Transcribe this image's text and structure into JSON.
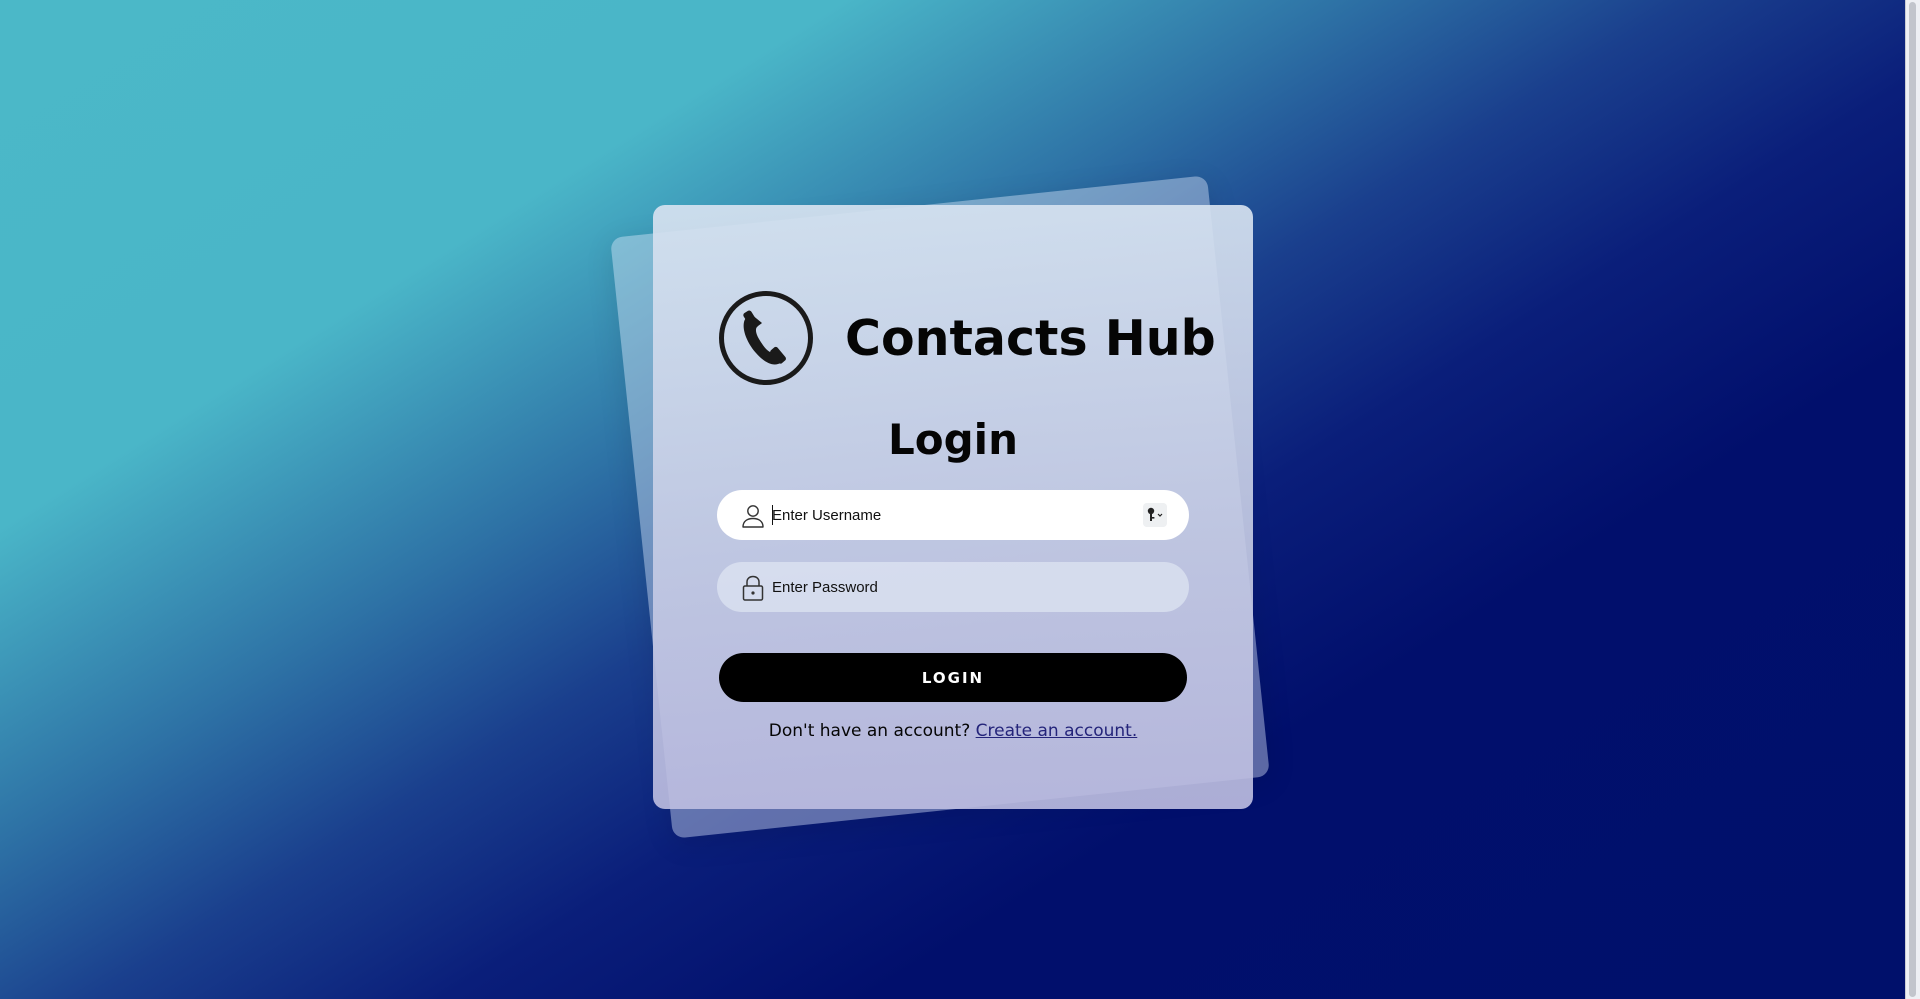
{
  "app": {
    "title": "Contacts Hub",
    "logo_icon": "phone-circle-icon"
  },
  "form": {
    "heading": "Login",
    "username": {
      "placeholder": "Enter Username",
      "value": "",
      "icon": "user-icon",
      "autofill_icon": "key-icon"
    },
    "password": {
      "placeholder": "Enter Password",
      "value": "",
      "icon": "lock-icon"
    },
    "submit_label": "LOGIN",
    "signup_prompt": "Don't have an account?",
    "signup_link": "Create an account."
  },
  "colors": {
    "gradient_start": "#4bb8c8",
    "gradient_end": "#00106b",
    "button": "#000000",
    "link": "#24247a"
  }
}
